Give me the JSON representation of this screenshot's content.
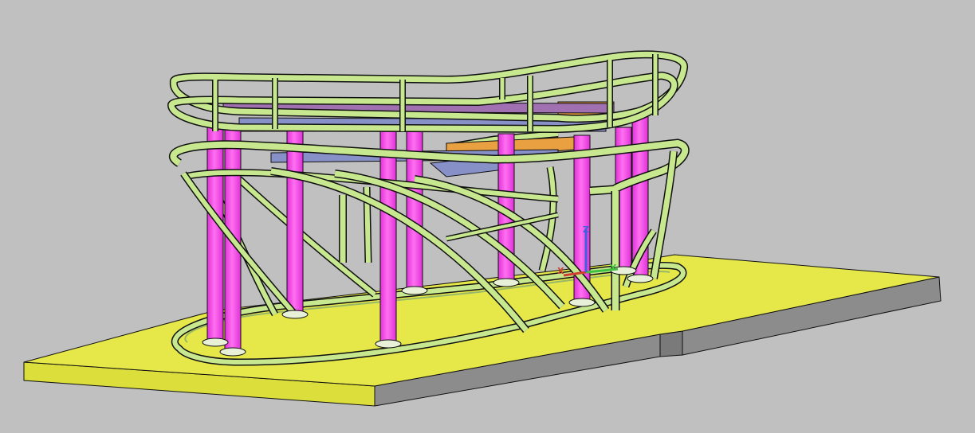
{
  "viewport": {
    "background": "#c0c0c0",
    "visual_style": "shaded"
  },
  "model": {
    "description_type": "3D steel structure",
    "colors": {
      "slab_top": "#e6e84a",
      "slab_front": "#dcde3c",
      "slab_side": "#8c8c8c",
      "column": "#e030d8",
      "column_highlight": "#ff70f0",
      "steel_member": "#c8e890",
      "steel_dark": "#98b868",
      "beam_blue": "#8890c8",
      "beam_orange": "#e8a040",
      "outline": "#101010"
    }
  },
  "ucs_icon": {
    "x_label": "X",
    "y_label": "Y",
    "z_label": "Z",
    "x_color": "#d04030",
    "y_color": "#40c040",
    "z_color": "#4060e0"
  }
}
